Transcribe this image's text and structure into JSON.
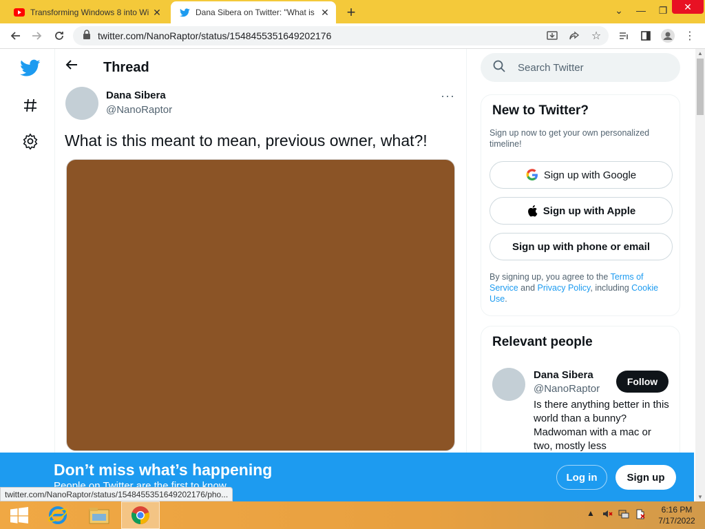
{
  "browser": {
    "tabs": [
      {
        "title": "Transforming Windows 8 into Wi",
        "icon": "youtube-icon",
        "active": false
      },
      {
        "title": "Dana Sibera on Twitter: \"What is",
        "icon": "twitter-icon",
        "active": true
      }
    ],
    "url": "twitter.com/NanoRaptor/status/1548455351649202176",
    "status_url": "twitter.com/NanoRaptor/status/1548455351649202176/pho..."
  },
  "thread": {
    "title": "Thread",
    "author_name": "Dana Sibera",
    "author_handle": "@NanoRaptor",
    "more": "···",
    "text": "What is this meant to mean, previous owner, what?!",
    "media_color": "#8b5426"
  },
  "search": {
    "placeholder": "Search Twitter"
  },
  "new_to_twitter": {
    "heading": "New to Twitter?",
    "subtext": "Sign up now to get your own personalized timeline!",
    "google": "Sign up with Google",
    "apple": "Sign up with Apple",
    "phone": "Sign up with phone or email",
    "legal_prefix": "By signing up, you agree to the ",
    "terms": "Terms of Service",
    "and": " and ",
    "privacy": "Privacy Policy",
    "including": ", including ",
    "cookie": "Cookie Use",
    "period": "."
  },
  "relevant": {
    "heading": "Relevant people",
    "name": "Dana Sibera",
    "handle": "@NanoRaptor",
    "follow": "Follow",
    "bio": "Is there anything better in this world than a bunny? Madwoman with a mac or two, mostly less"
  },
  "banner": {
    "title": "Don’t miss what’s happening",
    "subtitle": "People on Twitter are the first to know.",
    "login": "Log in",
    "signup": "Sign up"
  },
  "taskbar": {
    "time": "6:16 PM",
    "date": "7/17/2022"
  },
  "colors": {
    "twitter_blue": "#1d9bf0",
    "tabstrip": "#f4c93a"
  }
}
